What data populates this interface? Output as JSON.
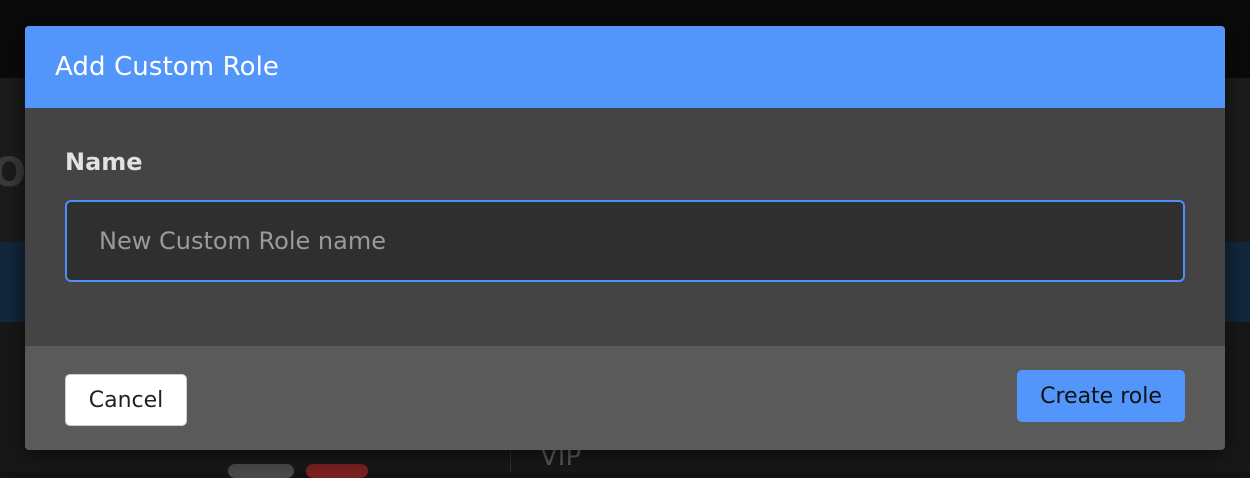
{
  "background": {
    "partial_heading_letter": "O",
    "list_item_label": "VIP"
  },
  "modal": {
    "title": "Add Custom Role",
    "name_field": {
      "label": "Name",
      "value": "",
      "placeholder": "New Custom Role name"
    },
    "footer": {
      "cancel_label": "Cancel",
      "create_label": "Create role"
    }
  },
  "colors": {
    "accent": "#5296fb",
    "modal_body": "#444444",
    "modal_footer": "#5a5a5a",
    "input_border": "#4f8ff5"
  }
}
